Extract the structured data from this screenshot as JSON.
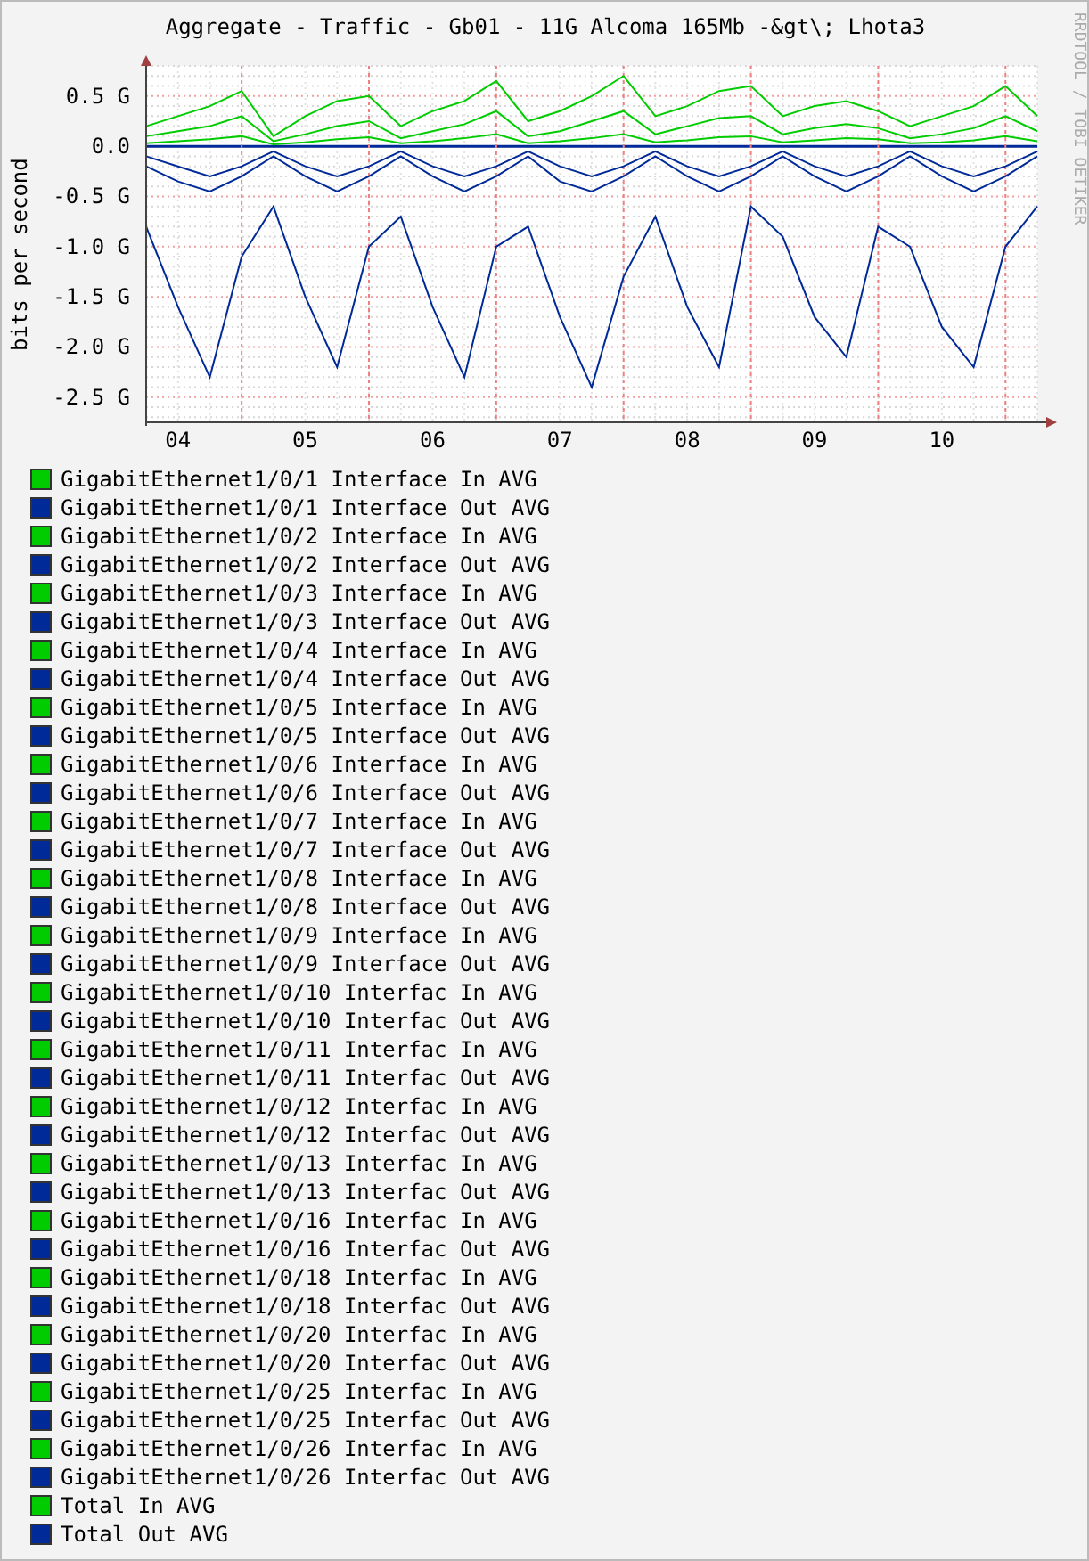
{
  "graph": {
    "title": "Aggregate - Traffic - Gb01 - 11G Alcoma 165Mb -&gt\\; Lhota3",
    "ylabel": "bits per second",
    "side_note": "RRDTOOL / TOBI OETIKER",
    "chart_data": {
      "type": "line",
      "x": [
        3.75,
        4,
        4.25,
        4.5,
        4.75,
        5,
        5.25,
        5.5,
        5.75,
        6,
        6.25,
        6.5,
        6.75,
        7,
        7.25,
        7.5,
        7.75,
        8,
        8.25,
        8.5,
        8.75,
        9,
        9.25,
        9.5,
        9.75,
        10,
        10.25,
        10.5,
        10.75
      ],
      "xticks": [
        {
          "value": 4,
          "label": "04"
        },
        {
          "value": 5,
          "label": "05"
        },
        {
          "value": 6,
          "label": "06"
        },
        {
          "value": 7,
          "label": "07"
        },
        {
          "value": 8,
          "label": "08"
        },
        {
          "value": 9,
          "label": "09"
        },
        {
          "value": 10,
          "label": "10"
        }
      ],
      "yticks": [
        {
          "value": 0.5,
          "label": "0.5 G"
        },
        {
          "value": 0,
          "label": "0.0"
        },
        {
          "value": -0.5,
          "label": "-0.5 G"
        },
        {
          "value": -1,
          "label": "-1.0 G"
        },
        {
          "value": -1.5,
          "label": "-1.5 G"
        },
        {
          "value": -2,
          "label": "-2.0 G"
        },
        {
          "value": -2.5,
          "label": "-2.5 G"
        }
      ],
      "xlim": [
        3.75,
        10.75
      ],
      "ylim": [
        -2.75,
        0.8
      ],
      "grid": true,
      "ref_lines": [
        {
          "axis": "y",
          "value": 0,
          "color": "#002a97"
        },
        {
          "axis": "x",
          "value": 4.5,
          "color": "#f08080"
        },
        {
          "axis": "x",
          "value": 5.5,
          "color": "#f08080"
        },
        {
          "axis": "x",
          "value": 6.5,
          "color": "#f08080"
        },
        {
          "axis": "x",
          "value": 7.5,
          "color": "#f08080"
        },
        {
          "axis": "x",
          "value": 8.5,
          "color": "#f08080"
        },
        {
          "axis": "x",
          "value": 9.5,
          "color": "#f08080"
        },
        {
          "axis": "x",
          "value": 10.5,
          "color": "#f08080"
        }
      ],
      "series": [
        {
          "color": "#00cc00",
          "values": [
            0.2,
            0.3,
            0.4,
            0.55,
            0.1,
            0.3,
            0.45,
            0.5,
            0.2,
            0.35,
            0.45,
            0.65,
            0.25,
            0.35,
            0.5,
            0.7,
            0.3,
            0.4,
            0.55,
            0.6,
            0.3,
            0.4,
            0.45,
            0.35,
            0.2,
            0.3,
            0.4,
            0.6,
            0.3
          ]
        },
        {
          "color": "#00cc00",
          "values": [
            0.1,
            0.15,
            0.2,
            0.3,
            0.05,
            0.12,
            0.2,
            0.25,
            0.08,
            0.15,
            0.22,
            0.35,
            0.1,
            0.15,
            0.25,
            0.35,
            0.12,
            0.2,
            0.28,
            0.3,
            0.12,
            0.18,
            0.22,
            0.18,
            0.08,
            0.12,
            0.18,
            0.3,
            0.15
          ]
        },
        {
          "color": "#00cc00",
          "values": [
            0.03,
            0.05,
            0.07,
            0.1,
            0.02,
            0.04,
            0.07,
            0.09,
            0.03,
            0.05,
            0.08,
            0.12,
            0.03,
            0.05,
            0.08,
            0.12,
            0.04,
            0.06,
            0.09,
            0.1,
            0.04,
            0.06,
            0.08,
            0.07,
            0.03,
            0.04,
            0.06,
            0.1,
            0.05
          ]
        },
        {
          "color": "#002a97",
          "values": [
            -0.2,
            -0.35,
            -0.45,
            -0.3,
            -0.1,
            -0.3,
            -0.45,
            -0.3,
            -0.1,
            -0.3,
            -0.45,
            -0.3,
            -0.1,
            -0.35,
            -0.45,
            -0.3,
            -0.1,
            -0.3,
            -0.45,
            -0.3,
            -0.1,
            -0.3,
            -0.45,
            -0.3,
            -0.1,
            -0.3,
            -0.45,
            -0.3,
            -0.1
          ]
        },
        {
          "color": "#002a97",
          "values": [
            -0.1,
            -0.2,
            -0.3,
            -0.2,
            -0.05,
            -0.2,
            -0.3,
            -0.2,
            -0.05,
            -0.2,
            -0.3,
            -0.2,
            -0.05,
            -0.2,
            -0.3,
            -0.2,
            -0.05,
            -0.2,
            -0.3,
            -0.2,
            -0.05,
            -0.2,
            -0.3,
            -0.2,
            -0.05,
            -0.2,
            -0.3,
            -0.2,
            -0.05
          ]
        },
        {
          "color": "#002a97",
          "values": [
            -0.8,
            -1.6,
            -2.3,
            -1.1,
            -0.6,
            -1.5,
            -2.2,
            -1.0,
            -0.7,
            -1.6,
            -2.3,
            -1.0,
            -0.8,
            -1.7,
            -2.4,
            -1.3,
            -0.7,
            -1.6,
            -2.2,
            -0.6,
            -0.9,
            -1.7,
            -2.1,
            -0.8,
            -1.0,
            -1.8,
            -2.2,
            -1.0,
            -0.6
          ]
        }
      ]
    }
  },
  "legend": [
    {
      "label": "GigabitEthernet1/0/1 Interface In AVG",
      "color": "#00cc00"
    },
    {
      "label": "GigabitEthernet1/0/1 Interface Out AVG",
      "color": "#002a97"
    },
    {
      "label": "GigabitEthernet1/0/2 Interface In AVG",
      "color": "#00cc00"
    },
    {
      "label": "GigabitEthernet1/0/2 Interface Out AVG",
      "color": "#002a97"
    },
    {
      "label": "GigabitEthernet1/0/3 Interface In AVG",
      "color": "#00cc00"
    },
    {
      "label": "GigabitEthernet1/0/3 Interface Out AVG",
      "color": "#002a97"
    },
    {
      "label": "GigabitEthernet1/0/4 Interface In AVG",
      "color": "#00cc00"
    },
    {
      "label": "GigabitEthernet1/0/4 Interface Out AVG",
      "color": "#002a97"
    },
    {
      "label": "GigabitEthernet1/0/5 Interface In AVG",
      "color": "#00cc00"
    },
    {
      "label": "GigabitEthernet1/0/5 Interface Out AVG",
      "color": "#002a97"
    },
    {
      "label": "GigabitEthernet1/0/6 Interface In AVG",
      "color": "#00cc00"
    },
    {
      "label": "GigabitEthernet1/0/6 Interface Out AVG",
      "color": "#002a97"
    },
    {
      "label": "GigabitEthernet1/0/7 Interface In AVG",
      "color": "#00cc00"
    },
    {
      "label": "GigabitEthernet1/0/7 Interface Out AVG",
      "color": "#002a97"
    },
    {
      "label": "GigabitEthernet1/0/8 Interface In AVG",
      "color": "#00cc00"
    },
    {
      "label": "GigabitEthernet1/0/8 Interface Out AVG",
      "color": "#002a97"
    },
    {
      "label": "GigabitEthernet1/0/9 Interface In AVG",
      "color": "#00cc00"
    },
    {
      "label": "GigabitEthernet1/0/9 Interface Out AVG",
      "color": "#002a97"
    },
    {
      "label": "GigabitEthernet1/0/10 Interfac In AVG",
      "color": "#00cc00"
    },
    {
      "label": "GigabitEthernet1/0/10 Interfac Out AVG",
      "color": "#002a97"
    },
    {
      "label": "GigabitEthernet1/0/11 Interfac In AVG",
      "color": "#00cc00"
    },
    {
      "label": "GigabitEthernet1/0/11 Interfac Out AVG",
      "color": "#002a97"
    },
    {
      "label": "GigabitEthernet1/0/12 Interfac In AVG",
      "color": "#00cc00"
    },
    {
      "label": "GigabitEthernet1/0/12 Interfac Out AVG",
      "color": "#002a97"
    },
    {
      "label": "GigabitEthernet1/0/13 Interfac In AVG",
      "color": "#00cc00"
    },
    {
      "label": "GigabitEthernet1/0/13 Interfac Out AVG",
      "color": "#002a97"
    },
    {
      "label": "GigabitEthernet1/0/16 Interfac In AVG",
      "color": "#00cc00"
    },
    {
      "label": "GigabitEthernet1/0/16 Interfac Out AVG",
      "color": "#002a97"
    },
    {
      "label": "GigabitEthernet1/0/18 Interfac In AVG",
      "color": "#00cc00"
    },
    {
      "label": "GigabitEthernet1/0/18 Interfac Out AVG",
      "color": "#002a97"
    },
    {
      "label": "GigabitEthernet1/0/20 Interfac In AVG",
      "color": "#00cc00"
    },
    {
      "label": "GigabitEthernet1/0/20 Interfac Out AVG",
      "color": "#002a97"
    },
    {
      "label": "GigabitEthernet1/0/25 Interfac In AVG",
      "color": "#00cc00"
    },
    {
      "label": "GigabitEthernet1/0/25 Interfac Out AVG",
      "color": "#002a97"
    },
    {
      "label": "GigabitEthernet1/0/26 Interfac In AVG",
      "color": "#00cc00"
    },
    {
      "label": "GigabitEthernet1/0/26 Interfac Out AVG",
      "color": "#002a97"
    },
    {
      "label": "Total In AVG",
      "color": "#00cc00"
    },
    {
      "label": "Total Out AVG",
      "color": "#002a97"
    }
  ]
}
